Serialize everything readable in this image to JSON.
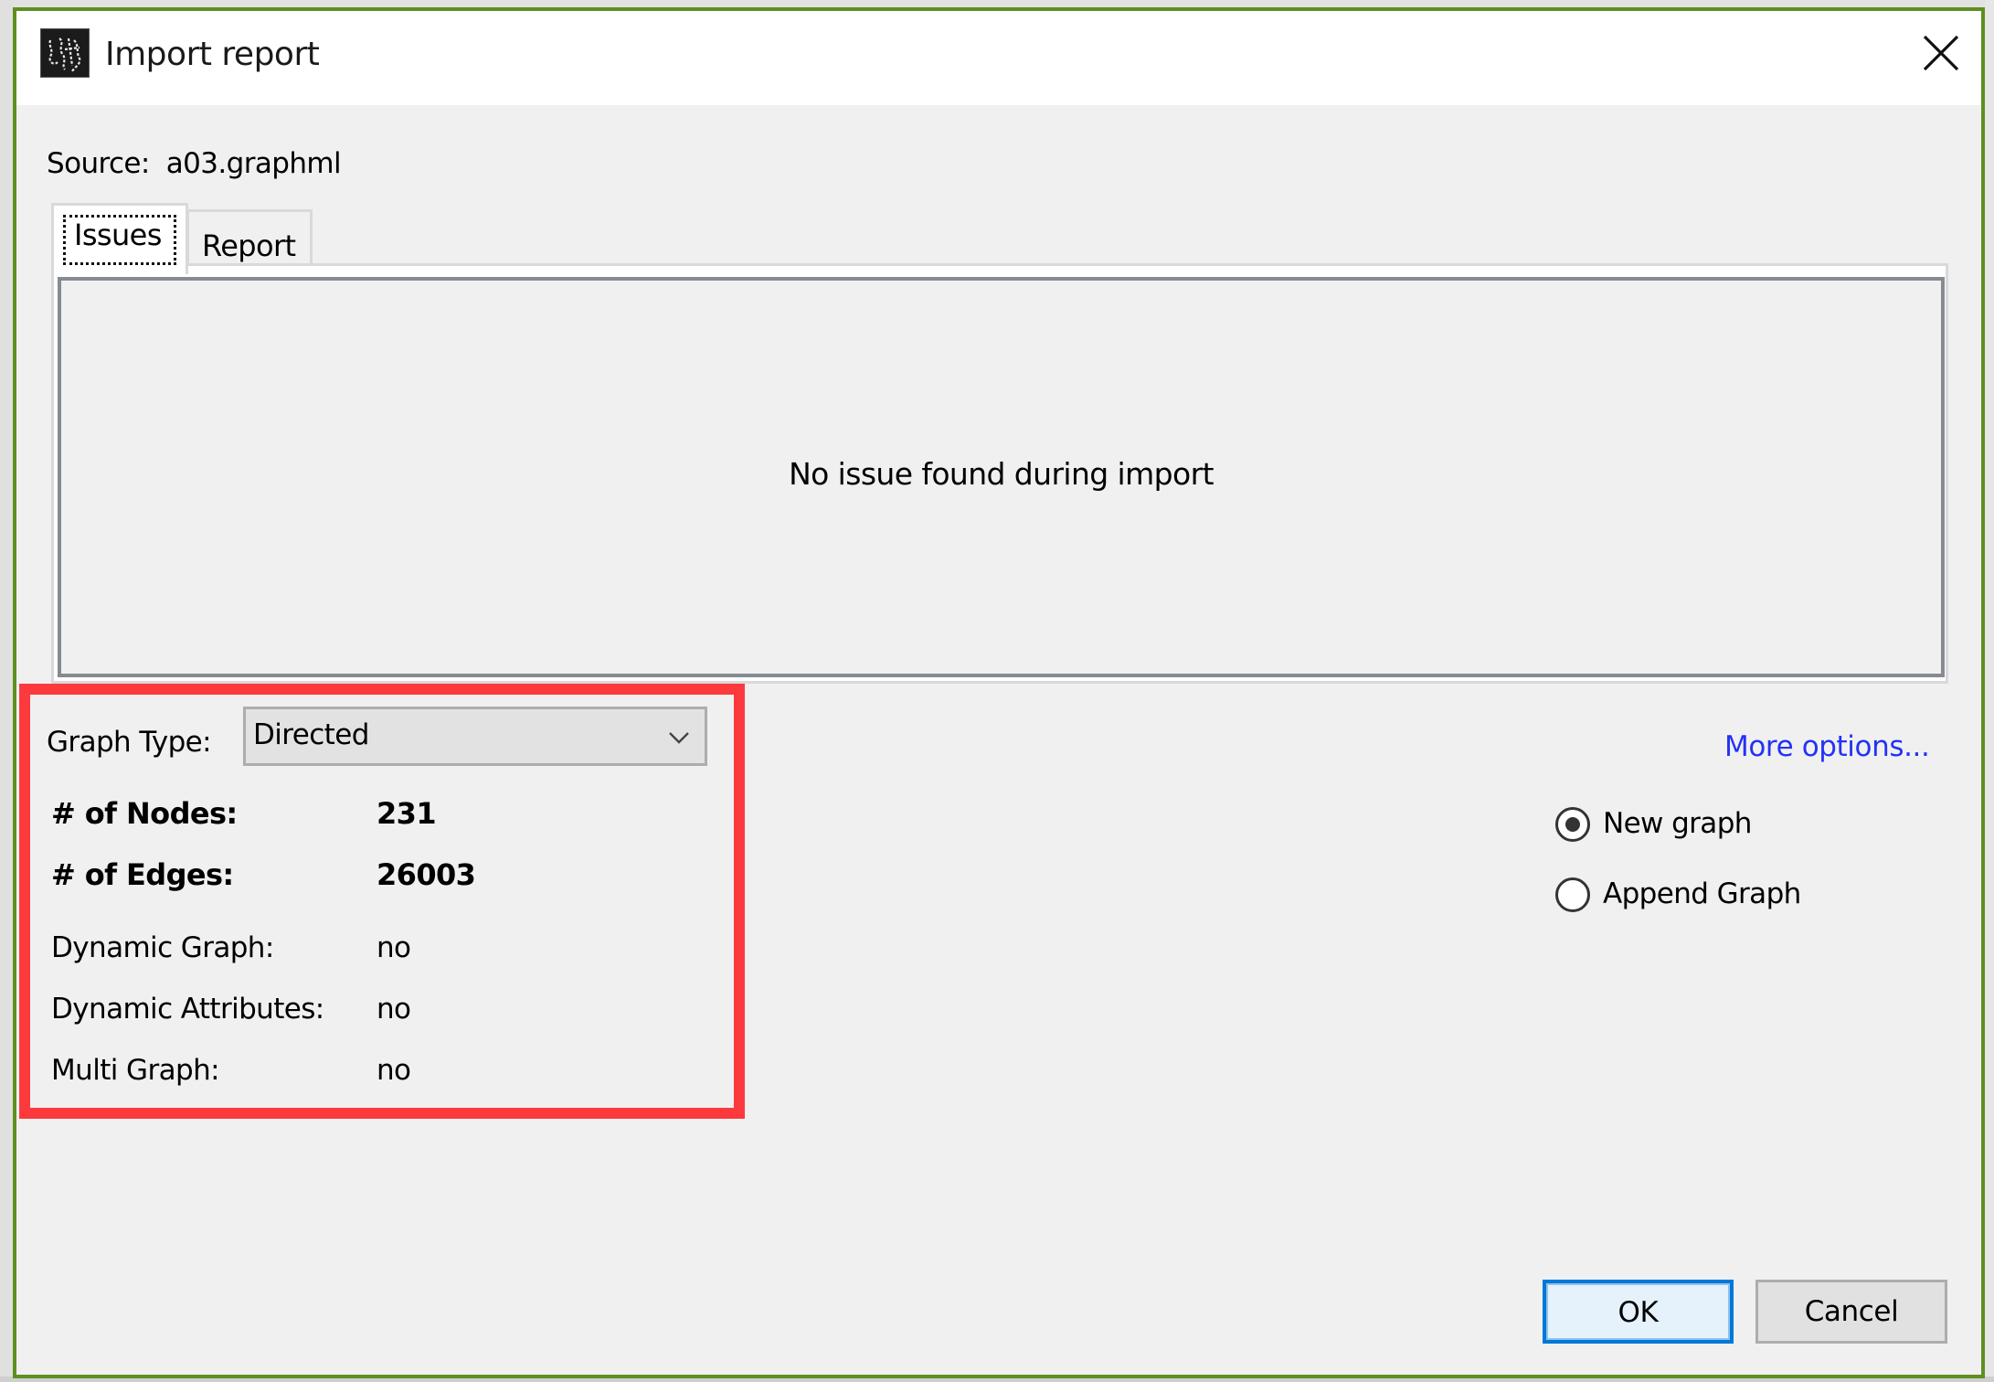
{
  "dialog": {
    "title": "Import report",
    "app_icon": "gephi-logo-icon",
    "close_icon": "close-icon",
    "border_color": "#5e8f1f"
  },
  "source": {
    "label": "Source:",
    "value": "a03.graphml"
  },
  "tabs": [
    {
      "label": "Issues",
      "active": true
    },
    {
      "label": "Report",
      "active": false
    }
  ],
  "issues_panel": {
    "message": "No issue found during import"
  },
  "graph_type": {
    "label": "Graph Type:",
    "selected": "Directed",
    "arrow_icon": "chevron-down-icon"
  },
  "stats": [
    {
      "label": "# of Nodes:",
      "value": "231",
      "bold": true
    },
    {
      "label": "# of Edges:",
      "value": "26003",
      "bold": true
    },
    {
      "label": "Dynamic Graph:",
      "value": "no",
      "bold": false
    },
    {
      "label": "Dynamic Attributes:",
      "value": "no",
      "bold": false
    },
    {
      "label": "Multi Graph:",
      "value": "no",
      "bold": false
    }
  ],
  "more_options": {
    "label": "More options...",
    "color": "#2432f5"
  },
  "import_mode": {
    "options": [
      {
        "label": "New graph",
        "selected": true
      },
      {
        "label": "Append Graph",
        "selected": false
      }
    ]
  },
  "buttons": {
    "ok": "OK",
    "cancel": "Cancel"
  },
  "annotation": {
    "highlight_color": "#fc3a3d"
  }
}
